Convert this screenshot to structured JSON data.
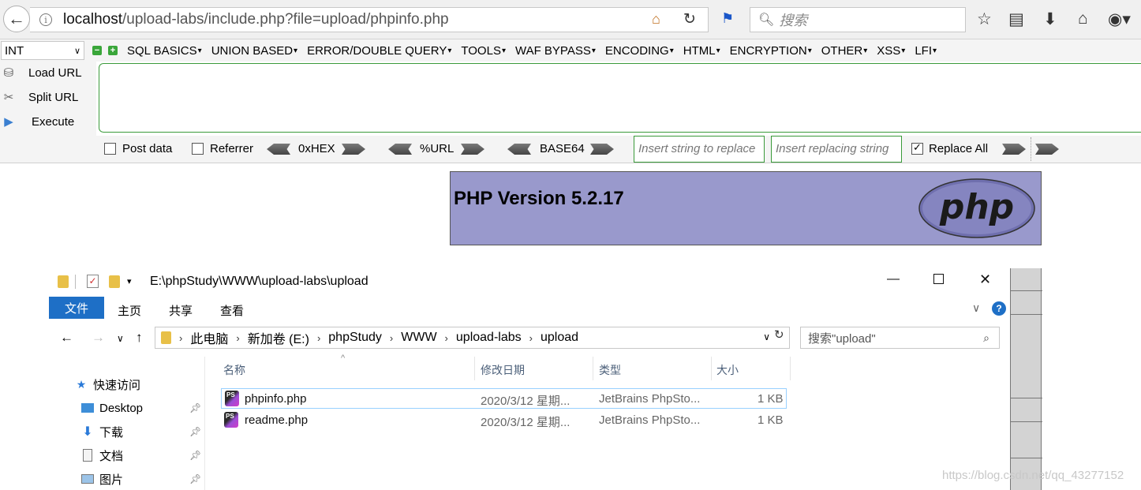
{
  "browser": {
    "url_host": "localhost",
    "url_path": "/upload-labs/include.php?file=upload/phpinfo.php",
    "search_placeholder": "搜索"
  },
  "hackbar": {
    "select_value": "INT",
    "menu": [
      "SQL BASICS",
      "UNION BASED",
      "ERROR/DOUBLE QUERY",
      "TOOLS",
      "WAF BYPASS",
      "ENCODING",
      "HTML",
      "ENCRYPTION",
      "OTHER",
      "XSS",
      "LFI"
    ],
    "actions": {
      "load_url": "Load URL",
      "split_url": "Split URL",
      "execute": "Execute"
    },
    "options": {
      "post_data": "Post data",
      "referrer": "Referrer",
      "hex": "0xHEX",
      "url": "%URL",
      "base64": "BASE64",
      "insert_replace": "Insert string to replace",
      "insert_replacing": "Insert replacing string",
      "replace_all": "Replace All"
    }
  },
  "php": {
    "version": "PHP Version 5.2.17",
    "logo_text": "php",
    "header_color": "#9999cc"
  },
  "explorer": {
    "title_path": "E:\\phpStudy\\WWW\\upload-labs\\upload",
    "ribbon": {
      "file": "文件",
      "home": "主页",
      "share": "共享",
      "view": "查看"
    },
    "breadcrumbs": [
      "此电脑",
      "新加卷 (E:)",
      "phpStudy",
      "WWW",
      "upload-labs",
      "upload"
    ],
    "search_placeholder": "搜索\"upload\"",
    "nav": {
      "quick_access": "快速访问",
      "items": [
        "Desktop",
        "下载",
        "文档",
        "图片"
      ]
    },
    "columns": {
      "name": "名称",
      "modified": "修改日期",
      "type": "类型",
      "size": "大小"
    },
    "files": [
      {
        "name": "phpinfo.php",
        "modified": "2020/3/12 星期...",
        "type": "JetBrains PhpSto...",
        "size": "1 KB"
      },
      {
        "name": "readme.php",
        "modified": "2020/3/12 星期...",
        "type": "JetBrains PhpSto...",
        "size": "1 KB"
      }
    ],
    "accent": "#1e6fc6"
  },
  "watermark": "https://blog.csdn.net/qq_43277152"
}
